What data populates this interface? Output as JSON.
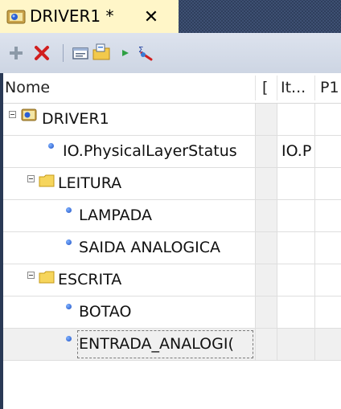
{
  "tab": {
    "title": "DRIVER1 *",
    "close_glyph": "✕",
    "icon": "driver-icon"
  },
  "toolbar": {
    "buttons": [
      {
        "icon": "add-icon"
      },
      {
        "icon": "delete-icon"
      },
      {
        "icon": "properties-icon"
      },
      {
        "icon": "new-folder-icon"
      },
      {
        "icon": "play-icon"
      },
      {
        "icon": "sum-tag-icon"
      }
    ]
  },
  "columns": [
    {
      "label": "Nome"
    },
    {
      "label": "["
    },
    {
      "label": "It..."
    },
    {
      "label": "P1"
    }
  ],
  "tree": [
    {
      "label": "DRIVER1",
      "type": "driver",
      "expanded": true,
      "value": ""
    },
    {
      "label": "IO.PhysicalLayerStatus",
      "type": "tag",
      "value": "IO.P"
    },
    {
      "label": "LEITURA",
      "type": "folder",
      "expanded": true,
      "value": ""
    },
    {
      "label": "LAMPADA",
      "type": "tag",
      "value": ""
    },
    {
      "label": "SAIDA ANALOGICA",
      "type": "tag",
      "value": ""
    },
    {
      "label": "ESCRITA",
      "type": "folder",
      "expanded": true,
      "value": ""
    },
    {
      "label": "BOTAO",
      "type": "tag",
      "value": ""
    },
    {
      "label": "ENTRADA_ANALOGI(",
      "type": "tag",
      "value": "",
      "selected": true
    }
  ],
  "colors": {
    "background": "#293955",
    "tab_active": "#fff6c8",
    "toolbar": "#cdd5e3",
    "grid_grey": "#f0f0f0"
  }
}
